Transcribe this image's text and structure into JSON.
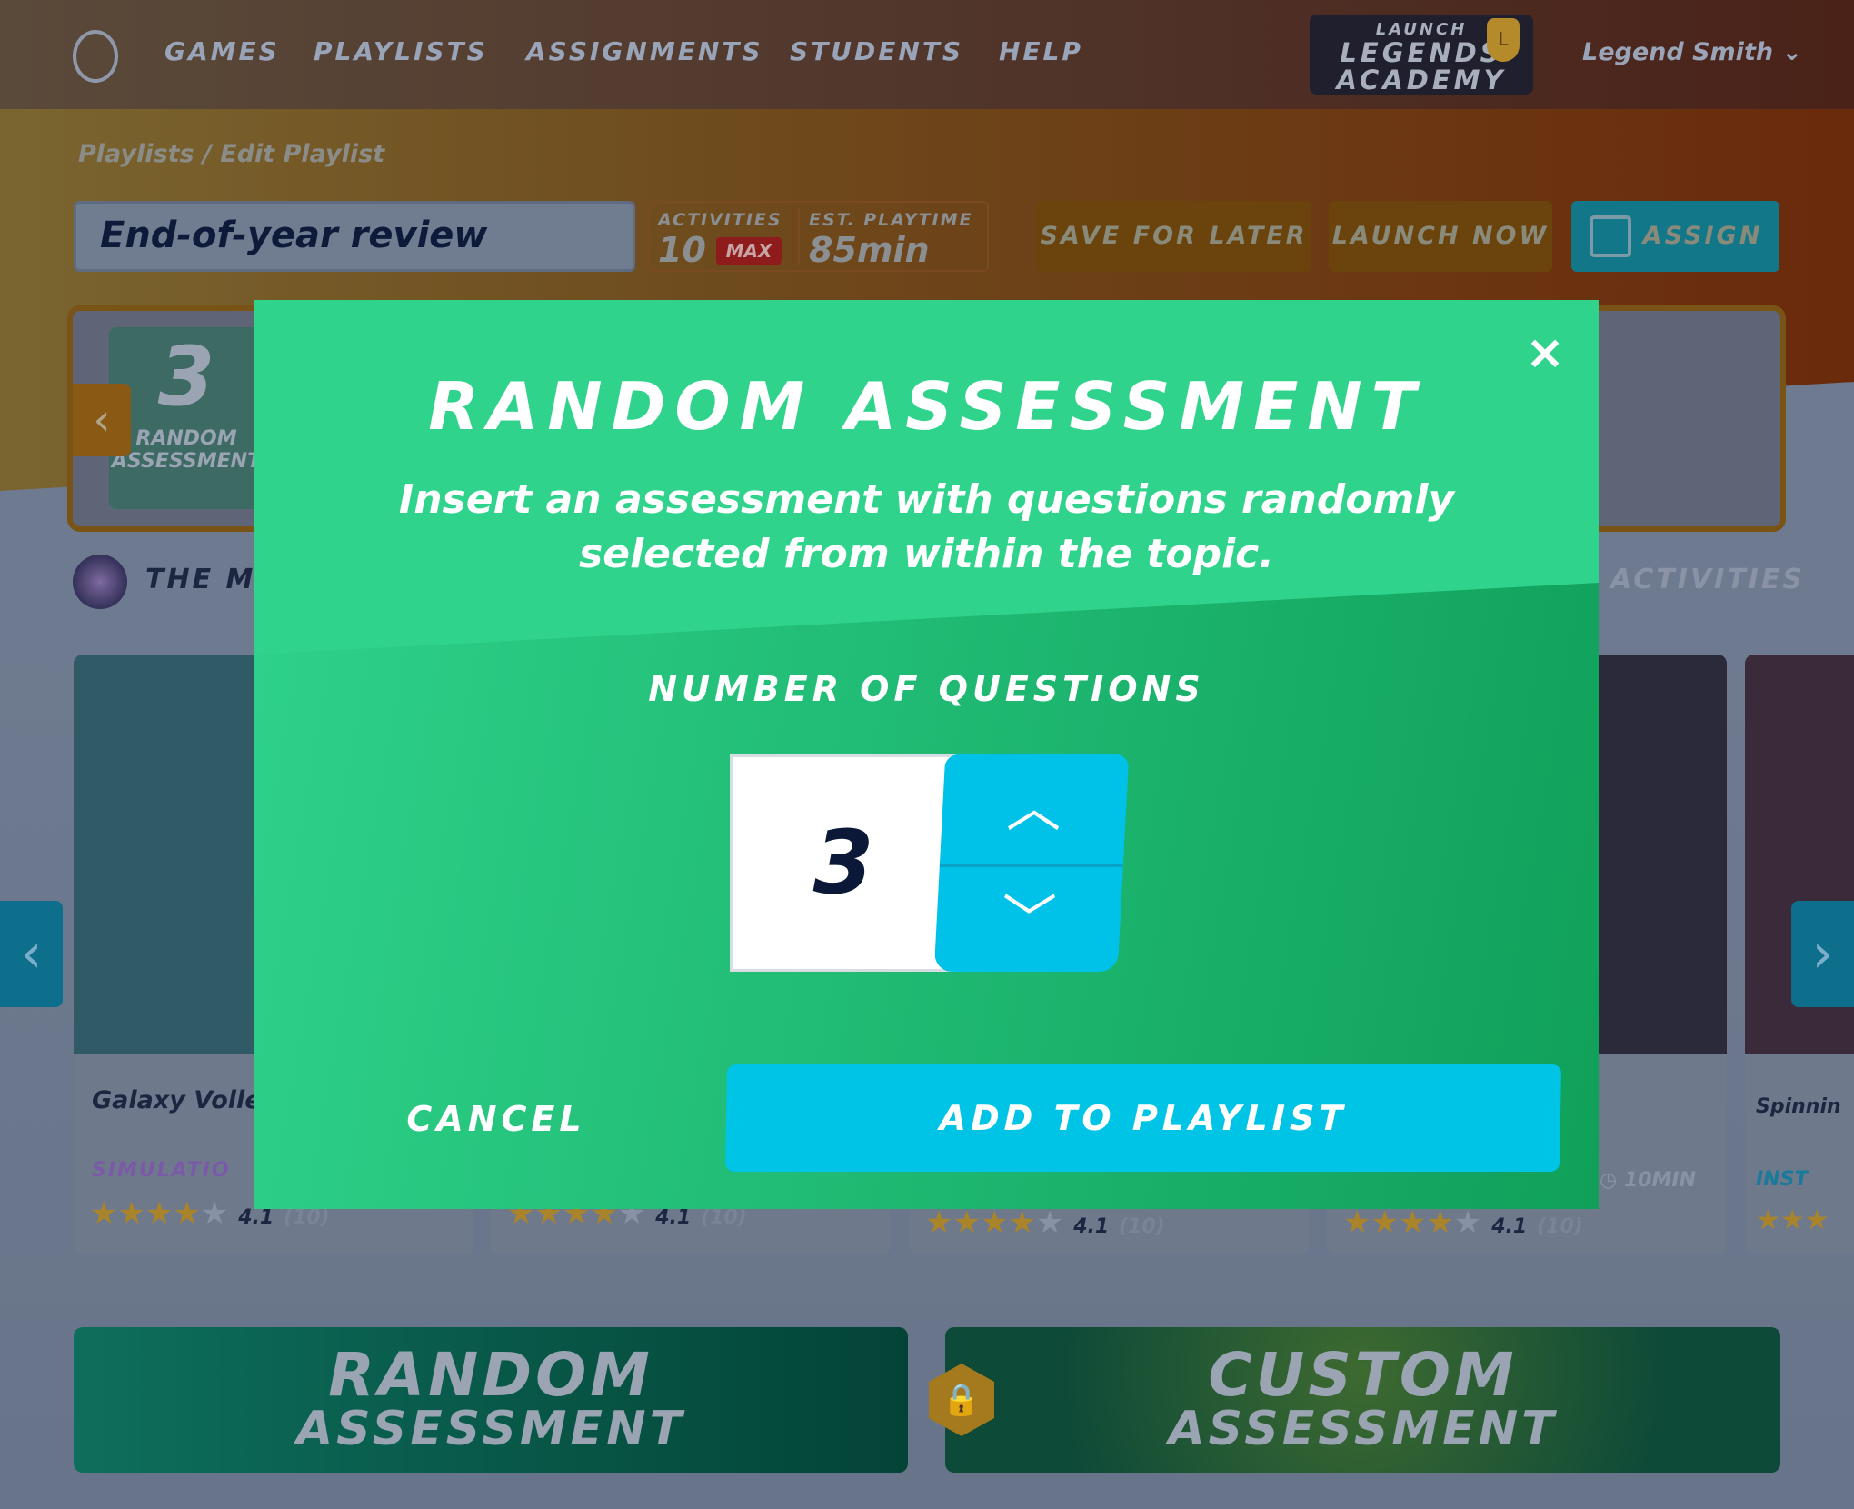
{
  "nav": {
    "items": [
      "GAMES",
      "PLAYLISTS",
      "ASSIGNMENTS",
      "STUDENTS",
      "HELP"
    ],
    "user": "Legend Smith"
  },
  "brand": {
    "line1": "LAUNCH",
    "line2": "LEGENDS",
    "line3": "ACADEMY"
  },
  "breadcrumb": "Playlists / Edit Playlist",
  "playlist": {
    "title": "End-of-year review",
    "activities_label": "ACTIVITIES",
    "activities_value": "10",
    "max_badge": "MAX",
    "playtime_label": "EST. PLAYTIME",
    "playtime_value": "85min"
  },
  "toolbar": {
    "save": "SAVE FOR LATER",
    "launch": "LAUNCH NOW",
    "assign": "ASSIGN"
  },
  "strip": {
    "item_number": "3",
    "item_label1": "RANDOM",
    "item_label2": "ASSESSMENT"
  },
  "section": {
    "title": "THE MI",
    "right": "ACTIVITIES"
  },
  "cards": [
    {
      "title": "Galaxy Volley",
      "type": "SIMULATIO",
      "rating": "4.1",
      "count": "(10)"
    },
    {
      "rating": "4.1",
      "count": "(10)"
    },
    {
      "rating": "4.1",
      "count": "(10)"
    },
    {
      "rating": "4.1",
      "count": "(10)",
      "duration": "10MIN"
    },
    {
      "title": "Spinnin",
      "type": "INST"
    }
  ],
  "bottom": {
    "random1": "RANDOM",
    "random2": "ASSESSMENT",
    "custom1": "CUSTOM",
    "custom2": "ASSESSMENT"
  },
  "modal": {
    "title": "RANDOM ASSESSMENT",
    "subtitle1": "Insert an assessment with questions randomly",
    "subtitle2": "selected from within the topic.",
    "label": "NUMBER OF QUESTIONS",
    "value": "3",
    "cancel": "CANCEL",
    "add": "ADD TO PLAYLIST",
    "close": "×"
  },
  "colors": {
    "modal_green": "#30d38c",
    "accent_cyan": "#00c4e6"
  }
}
